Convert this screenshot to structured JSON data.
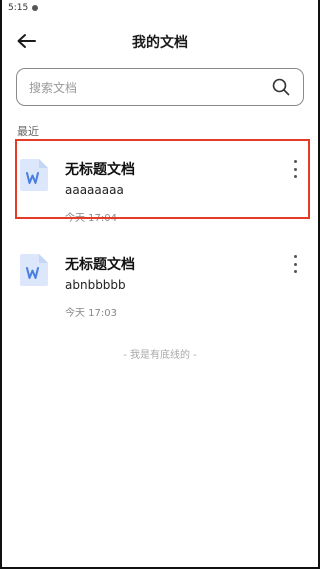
{
  "status_bar": {
    "time": "5:15"
  },
  "header": {
    "title": "我的文档"
  },
  "search": {
    "placeholder": "搜索文档"
  },
  "section": {
    "label": "最近"
  },
  "documents": [
    {
      "title": "无标题文档",
      "preview": "aaaaaaaa",
      "time": "今天 17:04",
      "icon": "word-doc-icon",
      "highlighted": true
    },
    {
      "title": "无标题文档",
      "preview": "abnbbbbb",
      "time": "今天 17:03",
      "icon": "word-doc-icon",
      "highlighted": false
    }
  ],
  "footer": {
    "end_text": "- 我是有底线的 -"
  },
  "colors": {
    "highlight": "#e53a26",
    "icon_blue": "#4a7fe0",
    "icon_bg": "#dce7fb"
  }
}
